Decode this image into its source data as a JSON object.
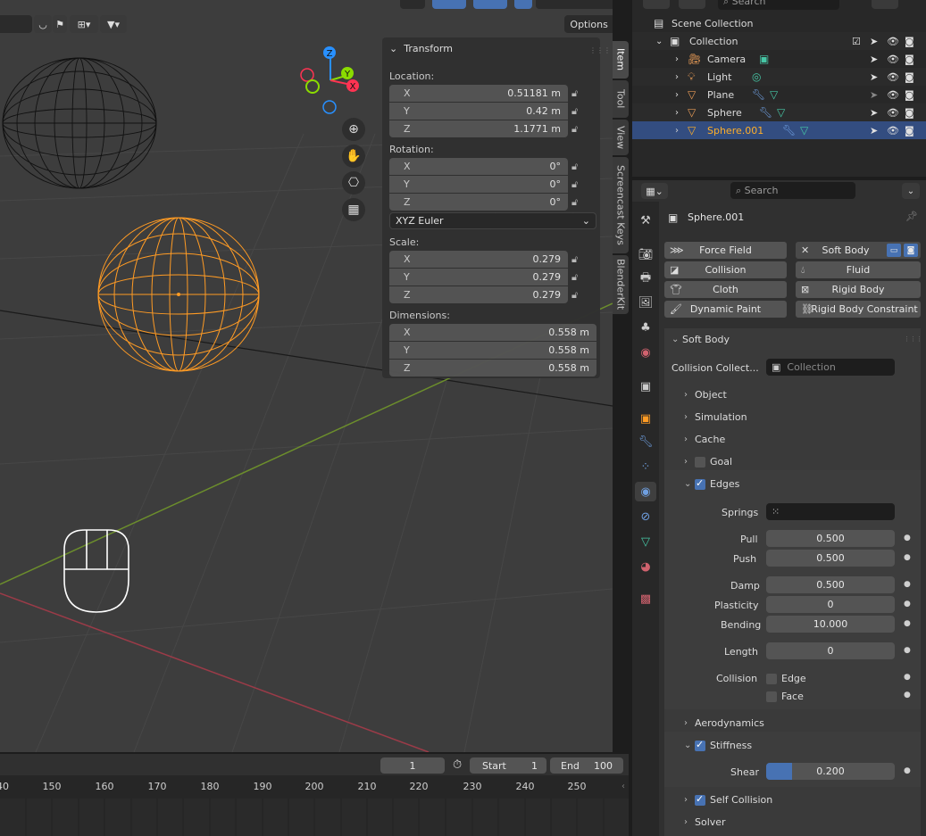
{
  "viewport": {
    "options_label": "Options",
    "transform_panel": {
      "title": "Transform",
      "location_label": "Location:",
      "location": [
        {
          "axis": "X",
          "value": "0.51181 m"
        },
        {
          "axis": "Y",
          "value": "0.42 m"
        },
        {
          "axis": "Z",
          "value": "1.1771 m"
        }
      ],
      "rotation_label": "Rotation:",
      "rotation": [
        {
          "axis": "X",
          "value": "0°"
        },
        {
          "axis": "Y",
          "value": "0°"
        },
        {
          "axis": "Z",
          "value": "0°"
        }
      ],
      "rotation_mode": "XYZ Euler",
      "scale_label": "Scale:",
      "scale": [
        {
          "axis": "X",
          "value": "0.279"
        },
        {
          "axis": "Y",
          "value": "0.279"
        },
        {
          "axis": "Z",
          "value": "0.279"
        }
      ],
      "dimensions_label": "Dimensions:",
      "dimensions": [
        {
          "axis": "X",
          "value": "0.558 m"
        },
        {
          "axis": "Y",
          "value": "0.558 m"
        },
        {
          "axis": "Z",
          "value": "0.558 m"
        }
      ]
    },
    "gizmo": {
      "z": "Z",
      "y": "Y",
      "x": "X"
    },
    "side_tabs": [
      "Item",
      "Tool",
      "View",
      "Screencast Keys",
      "BlenderKit"
    ]
  },
  "timeline": {
    "current_frame": "1",
    "start_label": "Start",
    "start_value": "1",
    "end_label": "End",
    "end_value": "100",
    "ticks": [
      "40",
      "150",
      "160",
      "170",
      "180",
      "190",
      "200",
      "210",
      "220",
      "230",
      "240",
      "250"
    ]
  },
  "outliner": {
    "search_placeholder": "Search",
    "rows": [
      {
        "label": "Scene Collection"
      },
      {
        "label": "Collection"
      },
      {
        "label": "Camera"
      },
      {
        "label": "Light"
      },
      {
        "label": "Plane"
      },
      {
        "label": "Sphere"
      },
      {
        "label": "Sphere.001"
      }
    ]
  },
  "properties": {
    "search_placeholder": "Search",
    "object_name": "Sphere.001",
    "physics_buttons": {
      "force_field": "Force Field",
      "soft_body": "Soft Body",
      "collision": "Collision",
      "fluid": "Fluid",
      "cloth": "Cloth",
      "rigid_body": "Rigid Body",
      "dynamic_paint": "Dynamic Paint",
      "rigid_body_constraint": "Rigid Body Constraint"
    },
    "soft_body": {
      "title": "Soft Body",
      "collision_collection_label": "Collision Collect...",
      "collision_collection_placeholder": "Collection",
      "object": "Object",
      "simulation": "Simulation",
      "cache": "Cache",
      "goal": "Goal",
      "edges": "Edges",
      "springs_label": "Springs",
      "pull_label": "Pull",
      "pull": "0.500",
      "push_label": "Push",
      "push": "0.500",
      "damp_label": "Damp",
      "damp": "0.500",
      "plasticity_label": "Plasticity",
      "plasticity": "0",
      "bending_label": "Bending",
      "bending": "10.000",
      "length_label": "Length",
      "length": "0",
      "collision_label": "Collision",
      "edge_label": "Edge",
      "face_label": "Face",
      "aerodynamics": "Aerodynamics",
      "stiffness": "Stiffness",
      "shear_label": "Shear",
      "shear": "0.200",
      "shear_fraction": 0.2,
      "self_collision": "Self Collision",
      "solver": "Solver"
    }
  },
  "colors": {
    "selection": "#ffaf29",
    "accent_blue": "#4772b3",
    "axis_x": "#ff3352",
    "axis_y": "#8bdc00",
    "axis_z": "#2890ff"
  }
}
